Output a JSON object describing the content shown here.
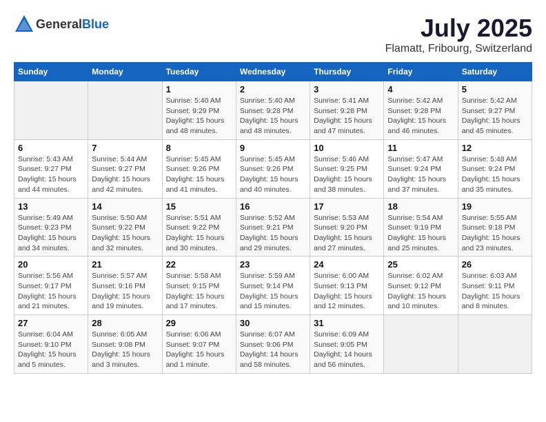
{
  "header": {
    "logo_general": "General",
    "logo_blue": "Blue",
    "month_year": "July 2025",
    "location": "Flamatt, Fribourg, Switzerland"
  },
  "weekdays": [
    "Sunday",
    "Monday",
    "Tuesday",
    "Wednesday",
    "Thursday",
    "Friday",
    "Saturday"
  ],
  "weeks": [
    [
      {
        "day": "",
        "info": ""
      },
      {
        "day": "",
        "info": ""
      },
      {
        "day": "1",
        "info": "Sunrise: 5:40 AM\nSunset: 9:29 PM\nDaylight: 15 hours\nand 48 minutes."
      },
      {
        "day": "2",
        "info": "Sunrise: 5:40 AM\nSunset: 9:28 PM\nDaylight: 15 hours\nand 48 minutes."
      },
      {
        "day": "3",
        "info": "Sunrise: 5:41 AM\nSunset: 9:28 PM\nDaylight: 15 hours\nand 47 minutes."
      },
      {
        "day": "4",
        "info": "Sunrise: 5:42 AM\nSunset: 9:28 PM\nDaylight: 15 hours\nand 46 minutes."
      },
      {
        "day": "5",
        "info": "Sunrise: 5:42 AM\nSunset: 9:27 PM\nDaylight: 15 hours\nand 45 minutes."
      }
    ],
    [
      {
        "day": "6",
        "info": "Sunrise: 5:43 AM\nSunset: 9:27 PM\nDaylight: 15 hours\nand 44 minutes."
      },
      {
        "day": "7",
        "info": "Sunrise: 5:44 AM\nSunset: 9:27 PM\nDaylight: 15 hours\nand 42 minutes."
      },
      {
        "day": "8",
        "info": "Sunrise: 5:45 AM\nSunset: 9:26 PM\nDaylight: 15 hours\nand 41 minutes."
      },
      {
        "day": "9",
        "info": "Sunrise: 5:45 AM\nSunset: 9:26 PM\nDaylight: 15 hours\nand 40 minutes."
      },
      {
        "day": "10",
        "info": "Sunrise: 5:46 AM\nSunset: 9:25 PM\nDaylight: 15 hours\nand 38 minutes."
      },
      {
        "day": "11",
        "info": "Sunrise: 5:47 AM\nSunset: 9:24 PM\nDaylight: 15 hours\nand 37 minutes."
      },
      {
        "day": "12",
        "info": "Sunrise: 5:48 AM\nSunset: 9:24 PM\nDaylight: 15 hours\nand 35 minutes."
      }
    ],
    [
      {
        "day": "13",
        "info": "Sunrise: 5:49 AM\nSunset: 9:23 PM\nDaylight: 15 hours\nand 34 minutes."
      },
      {
        "day": "14",
        "info": "Sunrise: 5:50 AM\nSunset: 9:22 PM\nDaylight: 15 hours\nand 32 minutes."
      },
      {
        "day": "15",
        "info": "Sunrise: 5:51 AM\nSunset: 9:22 PM\nDaylight: 15 hours\nand 30 minutes."
      },
      {
        "day": "16",
        "info": "Sunrise: 5:52 AM\nSunset: 9:21 PM\nDaylight: 15 hours\nand 29 minutes."
      },
      {
        "day": "17",
        "info": "Sunrise: 5:53 AM\nSunset: 9:20 PM\nDaylight: 15 hours\nand 27 minutes."
      },
      {
        "day": "18",
        "info": "Sunrise: 5:54 AM\nSunset: 9:19 PM\nDaylight: 15 hours\nand 25 minutes."
      },
      {
        "day": "19",
        "info": "Sunrise: 5:55 AM\nSunset: 9:18 PM\nDaylight: 15 hours\nand 23 minutes."
      }
    ],
    [
      {
        "day": "20",
        "info": "Sunrise: 5:56 AM\nSunset: 9:17 PM\nDaylight: 15 hours\nand 21 minutes."
      },
      {
        "day": "21",
        "info": "Sunrise: 5:57 AM\nSunset: 9:16 PM\nDaylight: 15 hours\nand 19 minutes."
      },
      {
        "day": "22",
        "info": "Sunrise: 5:58 AM\nSunset: 9:15 PM\nDaylight: 15 hours\nand 17 minutes."
      },
      {
        "day": "23",
        "info": "Sunrise: 5:59 AM\nSunset: 9:14 PM\nDaylight: 15 hours\nand 15 minutes."
      },
      {
        "day": "24",
        "info": "Sunrise: 6:00 AM\nSunset: 9:13 PM\nDaylight: 15 hours\nand 12 minutes."
      },
      {
        "day": "25",
        "info": "Sunrise: 6:02 AM\nSunset: 9:12 PM\nDaylight: 15 hours\nand 10 minutes."
      },
      {
        "day": "26",
        "info": "Sunrise: 6:03 AM\nSunset: 9:11 PM\nDaylight: 15 hours\nand 8 minutes."
      }
    ],
    [
      {
        "day": "27",
        "info": "Sunrise: 6:04 AM\nSunset: 9:10 PM\nDaylight: 15 hours\nand 5 minutes."
      },
      {
        "day": "28",
        "info": "Sunrise: 6:05 AM\nSunset: 9:08 PM\nDaylight: 15 hours\nand 3 minutes."
      },
      {
        "day": "29",
        "info": "Sunrise: 6:06 AM\nSunset: 9:07 PM\nDaylight: 15 hours\nand 1 minute."
      },
      {
        "day": "30",
        "info": "Sunrise: 6:07 AM\nSunset: 9:06 PM\nDaylight: 14 hours\nand 58 minutes."
      },
      {
        "day": "31",
        "info": "Sunrise: 6:09 AM\nSunset: 9:05 PM\nDaylight: 14 hours\nand 56 minutes."
      },
      {
        "day": "",
        "info": ""
      },
      {
        "day": "",
        "info": ""
      }
    ]
  ]
}
